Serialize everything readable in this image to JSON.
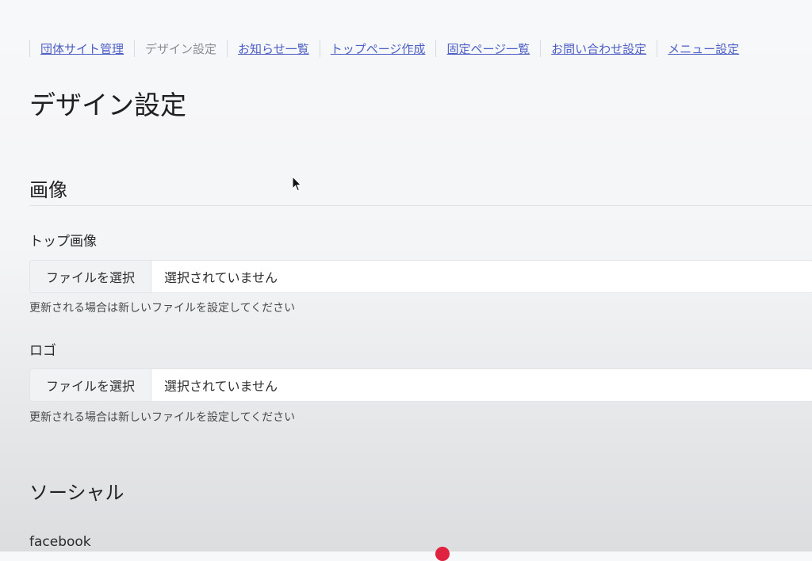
{
  "breadcrumb": [
    {
      "label": "団体サイト管理",
      "link": true
    },
    {
      "label": "デザイン設定",
      "link": false
    },
    {
      "label": "お知らせ一覧",
      "link": true
    },
    {
      "label": "トップページ作成",
      "link": true
    },
    {
      "label": "固定ページ一覧",
      "link": true
    },
    {
      "label": "お問い合わせ設定",
      "link": true
    },
    {
      "label": "メニュー設定",
      "link": true
    }
  ],
  "page": {
    "title": "デザイン設定"
  },
  "image_section": {
    "title": "画像",
    "top_image": {
      "label": "トップ画像",
      "button": "ファイルを選択",
      "value": "選択されていません",
      "help": "更新される場合は新しいファイルを設定してください"
    },
    "logo": {
      "label": "ロゴ",
      "button": "ファイルを選択",
      "value": "選択されていません",
      "help": "更新される場合は新しいファイルを設定してください"
    }
  },
  "social_section": {
    "title": "ソーシャル",
    "facebook_label": "facebook"
  },
  "icons": {
    "cursor": "mouse-pointer-icon",
    "record": "record-dot-icon"
  },
  "colors": {
    "link": "#4d5ec4",
    "current_crumb": "#8b8d92",
    "record_dot": "#e0213f"
  }
}
